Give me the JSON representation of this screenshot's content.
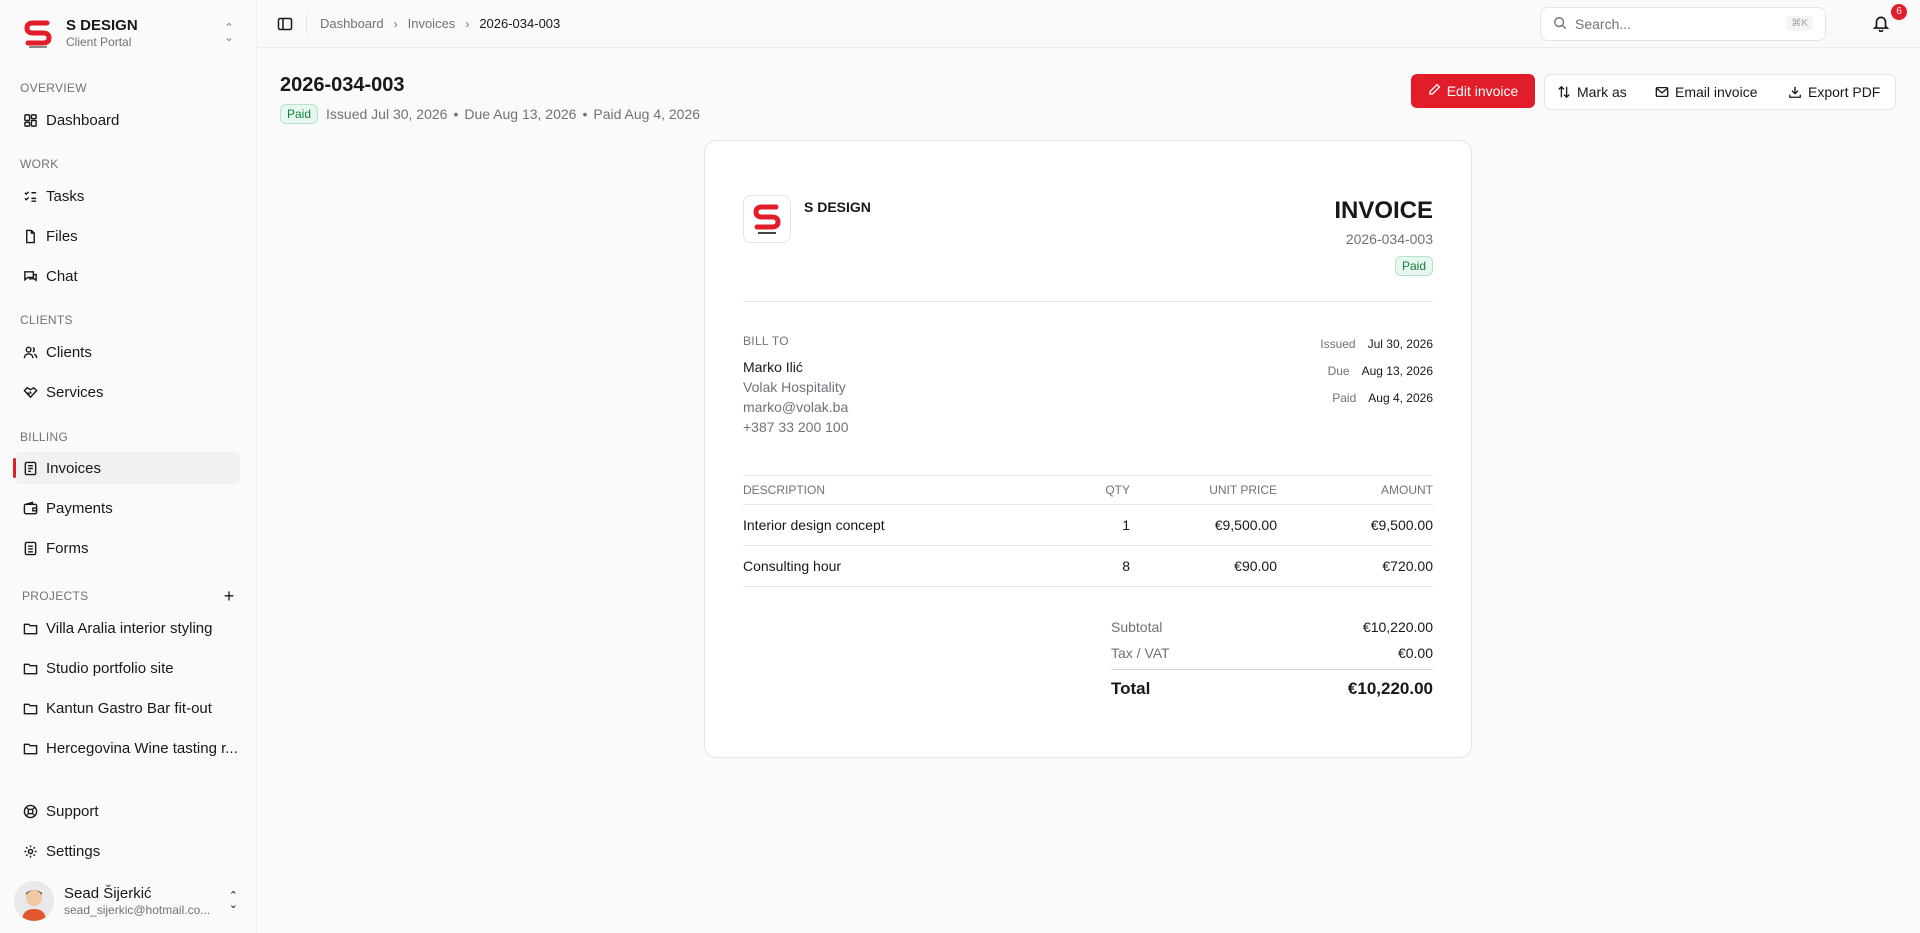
{
  "brand": {
    "name": "S DESIGN",
    "subtitle": "Client Portal",
    "logo_color": "#e11d2a"
  },
  "sidebar": {
    "sections": {
      "overview": "OVERVIEW",
      "work": "WORK",
      "clients": "CLIENTS",
      "billing": "BILLING",
      "projects": "PROJECTS"
    },
    "items": {
      "dashboard": "Dashboard",
      "tasks": "Tasks",
      "files": "Files",
      "chat": "Chat",
      "clients": "Clients",
      "services": "Services",
      "invoices": "Invoices",
      "payments": "Payments",
      "forms": "Forms",
      "support": "Support",
      "settings": "Settings"
    },
    "projects": [
      "Villa Aralia interior styling",
      "Studio portfolio site",
      "Kantun Gastro Bar fit-out",
      "Hercegovina Wine tasting r..."
    ],
    "active": "invoices"
  },
  "user": {
    "name": "Sead Šijerkić",
    "email": "sead_sijerkic@hotmail.co..."
  },
  "topbar": {
    "breadcrumbs": [
      "Dashboard",
      "Invoices",
      "2026-034-003"
    ],
    "search_placeholder": "Search...",
    "search_shortcut": "⌘K",
    "notification_count": "6"
  },
  "header": {
    "invoice_number": "2026-034-003",
    "status": "Paid",
    "issued": "Issued Jul 30, 2026",
    "due": "Due Aug 13, 2026",
    "paid": "Paid Aug 4, 2026",
    "dot": "•"
  },
  "actions": {
    "edit": "Edit invoice",
    "mark_as": "Mark as",
    "email": "Email invoice",
    "export": "Export PDF"
  },
  "invoice": {
    "company": "S DESIGN",
    "heading": "INVOICE",
    "number": "2026-034-003",
    "status": "Paid",
    "bill_to_label": "BILL TO",
    "bill_to": {
      "name": "Marko Ilić",
      "company": "Volak Hospitality",
      "email": "marko@volak.ba",
      "phone": "+387 33 200 100"
    },
    "dates": {
      "issued_label": "Issued",
      "issued": "Jul 30, 2026",
      "due_label": "Due",
      "due": "Aug 13, 2026",
      "paid_label": "Paid",
      "paid": "Aug 4, 2026"
    },
    "columns": {
      "description": "DESCRIPTION",
      "qty": "QTY",
      "unit_price": "UNIT PRICE",
      "amount": "AMOUNT"
    },
    "rows": [
      {
        "description": "Interior design concept",
        "qty": "1",
        "unit_price": "€9,500.00",
        "amount": "€9,500.00"
      },
      {
        "description": "Consulting hour",
        "qty": "8",
        "unit_price": "€90.00",
        "amount": "€720.00"
      }
    ],
    "totals": {
      "subtotal_label": "Subtotal",
      "subtotal": "€10,220.00",
      "tax_label": "Tax / VAT",
      "tax": "€0.00",
      "total_label": "Total",
      "total": "€10,220.00"
    }
  }
}
